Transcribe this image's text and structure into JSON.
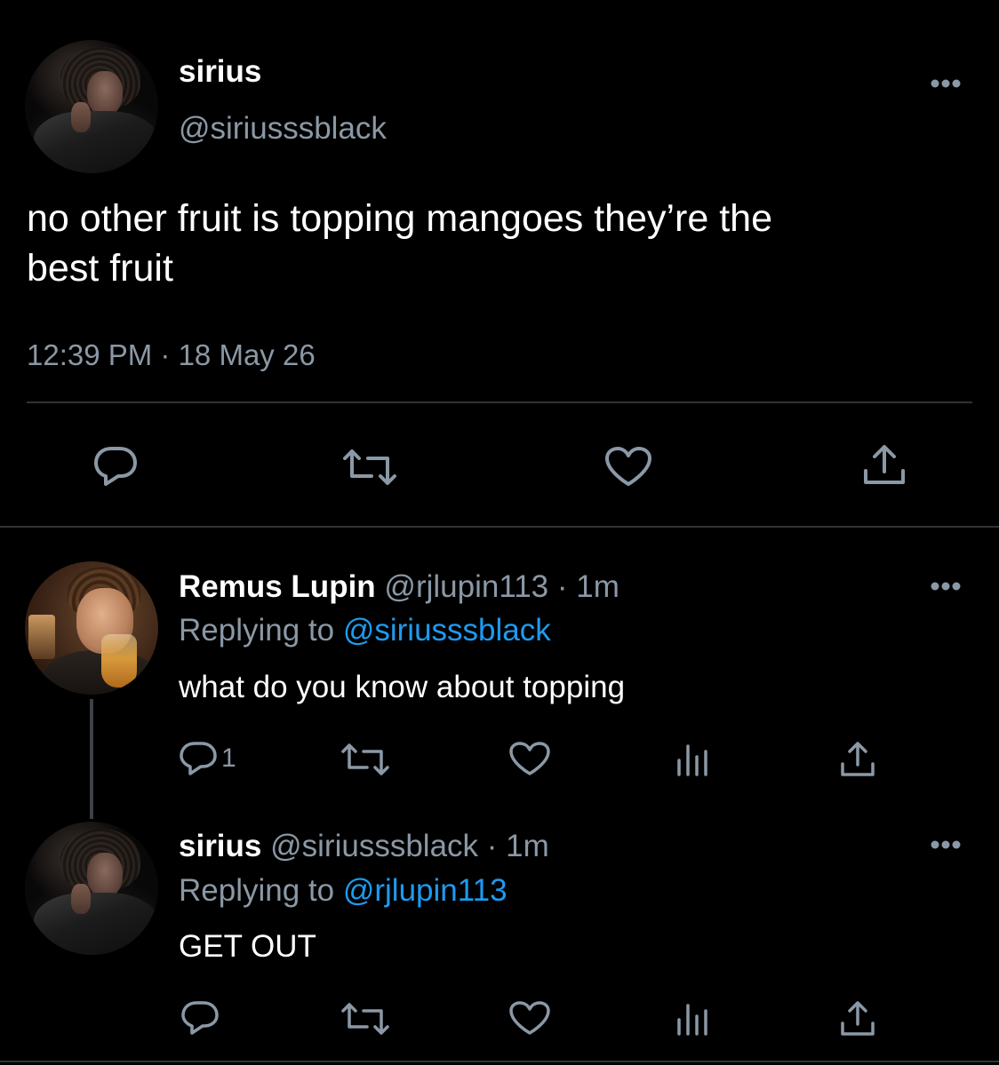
{
  "main_tweet": {
    "display_name": "sirius",
    "handle": "@siriusssblack",
    "text_line1": "no other fruit is topping mangoes they’re the",
    "text_line2": "best fruit",
    "timestamp": "12:39 PM · 18 May 26",
    "actions": [
      "reply-icon",
      "retweet-icon",
      "like-icon",
      "share-icon"
    ]
  },
  "replies": [
    {
      "display_name": "Remus Lupin",
      "handle": "@rjlupin113",
      "separator": "·",
      "time": "1m",
      "replying_prefix": "Replying to ",
      "replying_to": "@siriusssblack",
      "text": "what do you know about topping",
      "reply_count": "1",
      "actions": [
        "reply-icon",
        "retweet-icon",
        "like-icon",
        "analytics-icon",
        "share-icon"
      ]
    },
    {
      "display_name": "sirius",
      "handle": "@siriusssblack",
      "separator": "·",
      "time": "1m",
      "replying_prefix": "Replying to ",
      "replying_to": "@rjlupin113",
      "text": "GET OUT",
      "reply_count": "",
      "actions": [
        "reply-icon",
        "retweet-icon",
        "like-icon",
        "analytics-icon",
        "share-icon"
      ]
    }
  ],
  "colors": {
    "background": "#000000",
    "primary_text": "#ffffff",
    "secondary_text": "#8b98a5",
    "accent": "#1d9bf0",
    "divider": "#2f3336"
  }
}
